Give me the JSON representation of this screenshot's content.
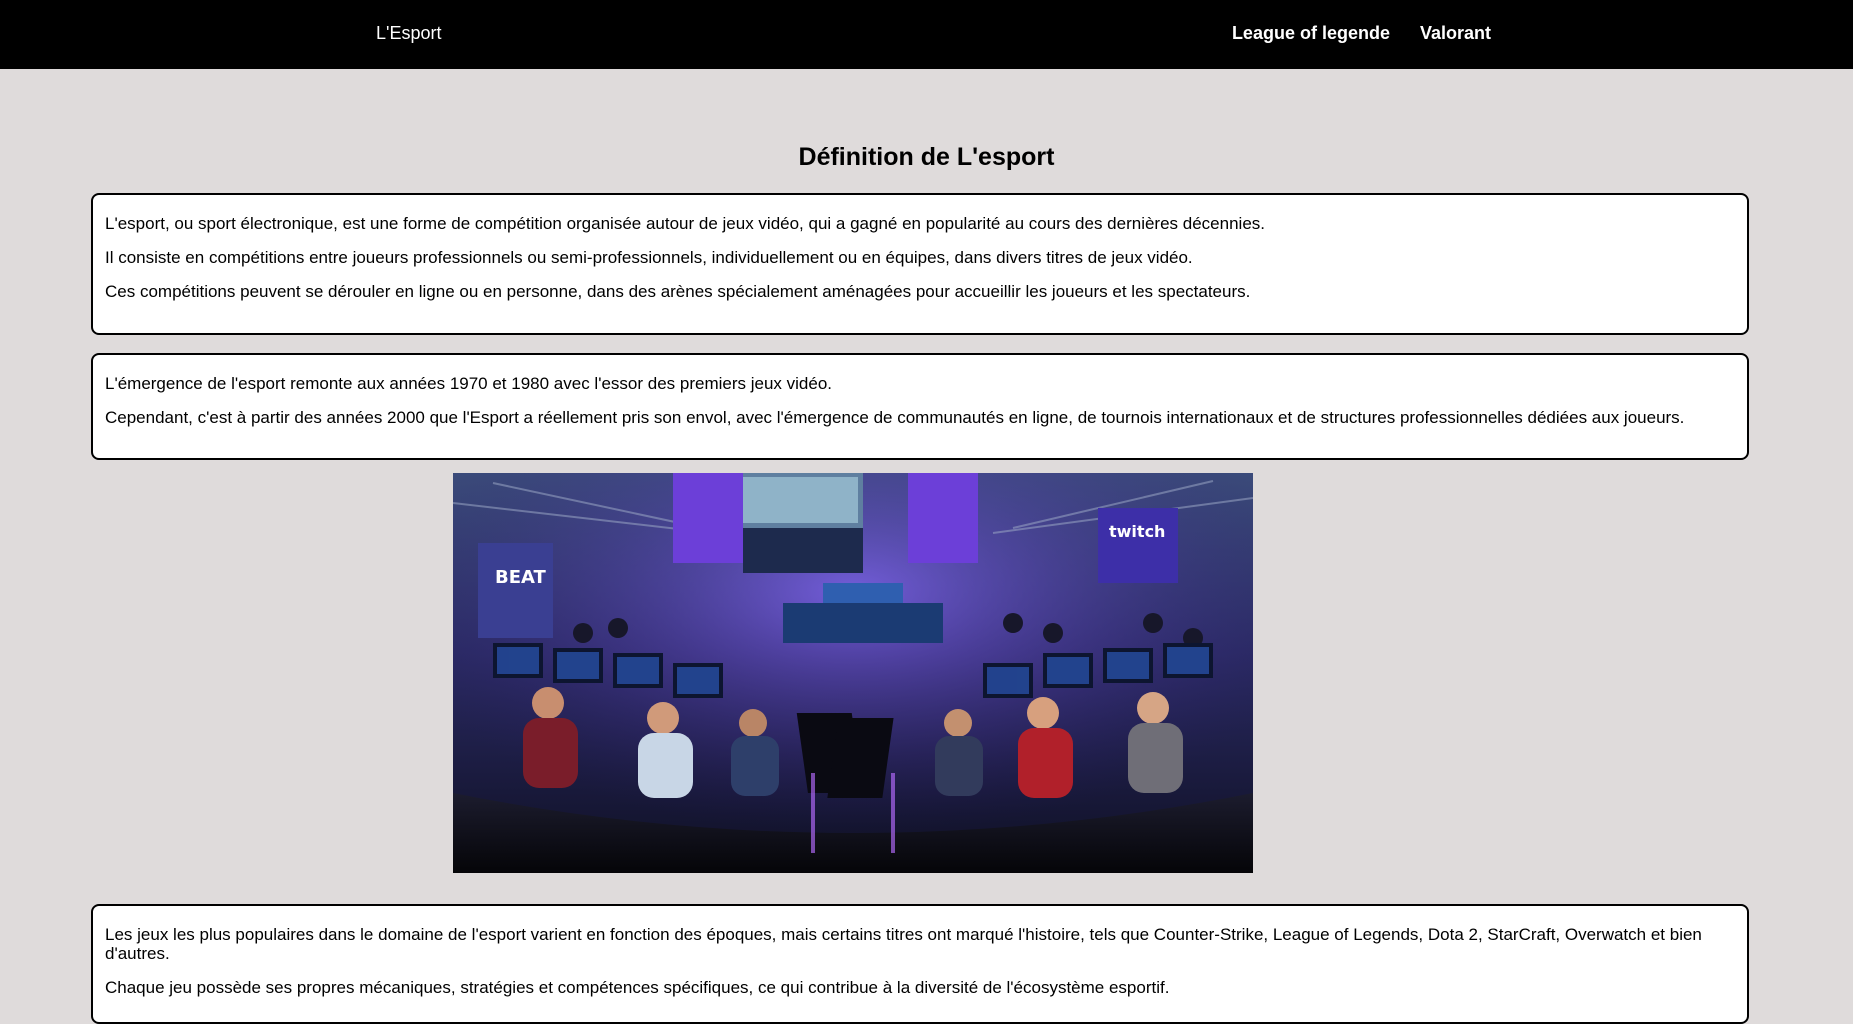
{
  "header": {
    "brand": "L'Esport",
    "nav": [
      {
        "label": "League of legende"
      },
      {
        "label": "Valorant"
      }
    ]
  },
  "main": {
    "title": "Définition de L'esport",
    "sections": [
      {
        "paragraphs": [
          "L'esport, ou sport électronique, est une forme de compétition organisée autour de jeux vidéo, qui a gagné en popularité au cours des dernières décennies.",
          "Il consiste en compétitions entre joueurs professionnels ou semi-professionnels, individuellement ou en équipes, dans divers titres de jeux vidéo.",
          "Ces compétitions peuvent se dérouler en ligne ou en personne, dans des arènes spécialement aménagées pour accueillir les joueurs et les spectateurs."
        ]
      },
      {
        "paragraphs": [
          "L'émergence de l'esport remonte aux années 1970 et 1980 avec l'essor des premiers jeux vidéo.",
          "Cependant, c'est à partir des années 2000 que l'Esport a réellement pris son envol, avec l'émergence de communautés en ligne, de tournois internationaux et de structures professionnelles dédiées aux joueurs."
        ]
      },
      {
        "paragraphs": [
          "Les jeux les plus populaires dans le domaine de l'esport varient en fonction des époques, mais certains titres ont marqué l'histoire, tels que Counter-Strike, League of Legends, Dota 2, StarCraft, Overwatch et bien d'autres.",
          "Chaque jeu possède ses propres mécaniques, stratégies et compétences spécifiques, ce qui contribue à la diversité de l'écosystème esportif."
        ]
      }
    ],
    "photo": {
      "signs": [
        "BEAT",
        "twitch"
      ]
    }
  },
  "colors": {
    "page_background": "#dfdbdb",
    "header_background": "#000000",
    "card_background": "#ffffff",
    "card_border": "#000000"
  }
}
